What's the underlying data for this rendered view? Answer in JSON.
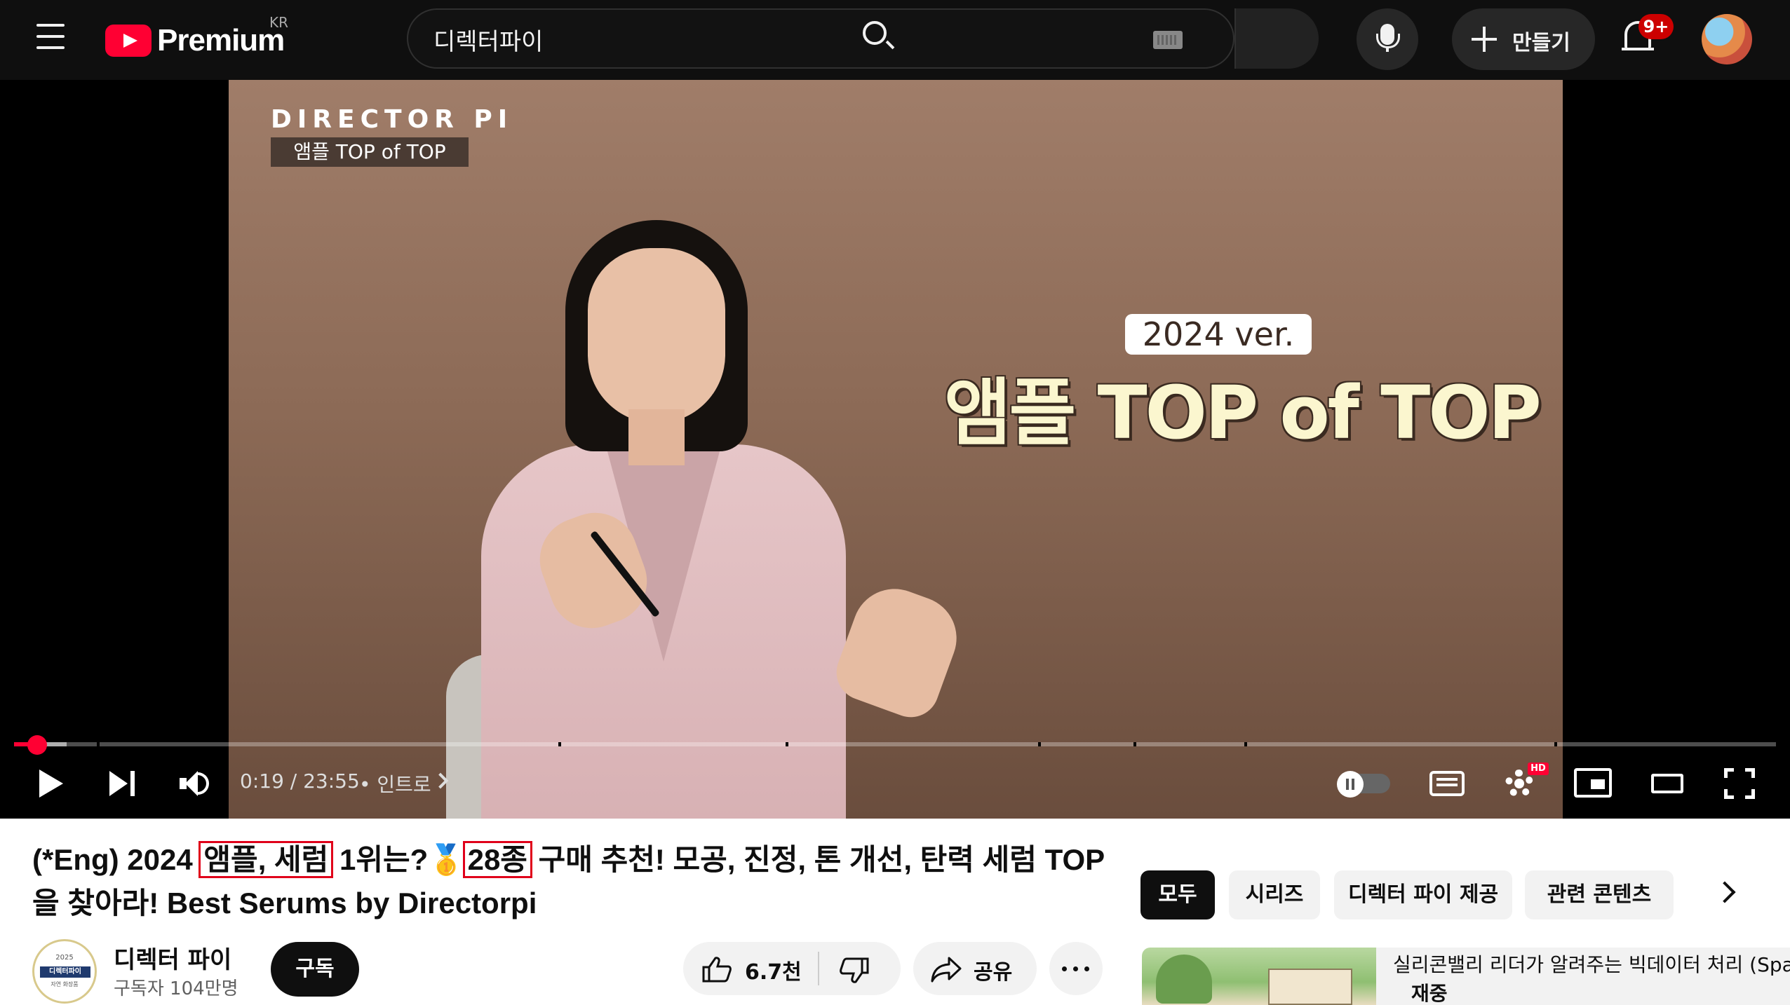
{
  "header": {
    "logo_text": "Premium",
    "country_code": "KR",
    "search_value": "디렉터파이",
    "create_label": "만들기",
    "notification_count": "9+"
  },
  "video_frame": {
    "brand": "DIRECTOR PI",
    "tag": "앰플 TOP of TOP",
    "version_pill": "2024 ver.",
    "headline": "앰플 TOP of TOP"
  },
  "player": {
    "time_current": "0:19",
    "time_total": "23:55",
    "time_display": "0:19 / 23:55",
    "chapter": "• 인트로",
    "progress_fraction": 0.0132,
    "buffer_fraction": 0.03,
    "hd_badge": "HD"
  },
  "video": {
    "title_part1": "(*Eng) 2024 ",
    "title_box1": "앰플, 세럼",
    "title_part2": " 1위는?",
    "title_medal": "🥇",
    "title_box2": "28종",
    "title_part3": " 구매 추천! 모공, 진정, 톤 개선, 탄력 세럼 TOP",
    "title_line2": "을 찾아라! Best Serums by Directorpi"
  },
  "channel": {
    "name": "디렉터 파이",
    "subscribers": "구독자 104만명",
    "subscribe_label": "구독",
    "logo_band": "디렉터파이",
    "logo_year": "2025",
    "logo_sub": "자연 화장품"
  },
  "actions": {
    "like_count": "6.7천",
    "share_label": "공유"
  },
  "chips": [
    {
      "label": "모두",
      "active": true
    },
    {
      "label": "시리즈",
      "active": false
    },
    {
      "label": "디렉터 파이 제공",
      "active": false
    },
    {
      "label": "관련 콘텐츠",
      "active": false
    }
  ],
  "recommendation": {
    "title": "실리콘밸리 리더가 알려주는 빅데이터 처리 (Spark)",
    "subtitle": "재중"
  }
}
